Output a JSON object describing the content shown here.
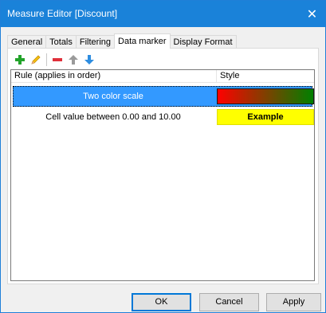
{
  "window": {
    "title": "Measure Editor [Discount]",
    "close_glyph": "✕"
  },
  "tabs": [
    {
      "label": "General",
      "active": false
    },
    {
      "label": "Totals",
      "active": false
    },
    {
      "label": "Filtering",
      "active": false
    },
    {
      "label": "Data marker",
      "active": true
    },
    {
      "label": "Display Format",
      "active": false
    }
  ],
  "toolbar": {
    "buttons": [
      {
        "icon": "add-icon",
        "color": "#22a32a"
      },
      {
        "icon": "edit-pencil-icon",
        "color": "#f0b400"
      },
      {
        "icon": "remove-icon",
        "color": "#e0303a"
      },
      {
        "icon": "move-up-icon",
        "color": "#9a9a9a"
      },
      {
        "icon": "move-down-icon",
        "color": "#2e8de0"
      }
    ]
  },
  "grid": {
    "columns": [
      "Rule (applies in order)",
      "Style"
    ],
    "rows": [
      {
        "rule": "Two color scale",
        "selected": true,
        "style_type": "gradient",
        "gradient_colors": [
          "#ff0000",
          "#008000"
        ]
      },
      {
        "rule": "Cell value between 0.00 and 10.00",
        "selected": false,
        "style_type": "example",
        "example_text": "Example",
        "example_bg": "#ffff00"
      }
    ]
  },
  "buttons": {
    "ok": "OK",
    "cancel": "Cancel",
    "apply": "Apply"
  },
  "colors": {
    "titlebar": "#1a82d9",
    "selection": "#3399ff"
  }
}
